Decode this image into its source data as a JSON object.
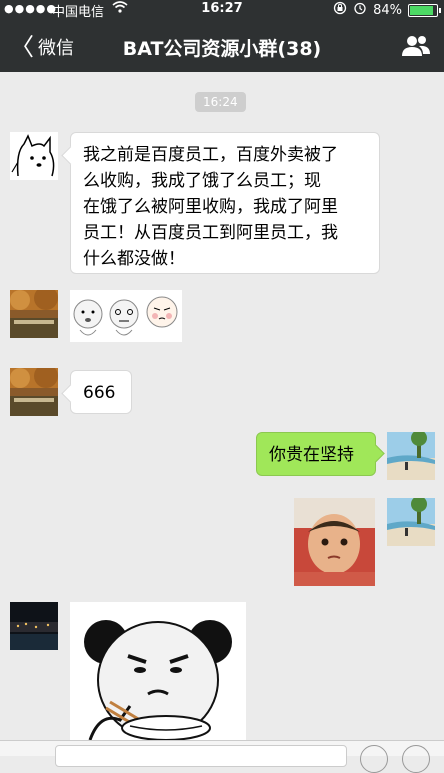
{
  "status": {
    "signal_dots": "●●●●●",
    "carrier": "中国电信",
    "time": "16:27",
    "battery": "84%",
    "battery_level": 0.84
  },
  "nav": {
    "back_label": "微信",
    "back_chevron": "〈",
    "title": "BAT公司资源小群(38)"
  },
  "chat": {
    "timestamp": "16:24",
    "messages": [
      {
        "text": "我之前是百度员工，百度外卖被了\n么收购，我成了饿了么员工；现\n在饿了么被阿里收购，我成了阿里\n员工！从百度员工到阿里员工，我\n什么都没做！"
      },
      {
        "text": "666"
      },
      {
        "text": "你贵在坚持"
      }
    ]
  },
  "icons": {
    "wifi": "wifi-icon",
    "lock": "rotation-lock-icon",
    "alarm": "alarm-icon",
    "people": "group-info-icon"
  },
  "colors": {
    "navbar": "#2e3132",
    "background": "#ebebeb",
    "own_bubble": "#a0e759",
    "battery_fill": "#4cd964"
  }
}
